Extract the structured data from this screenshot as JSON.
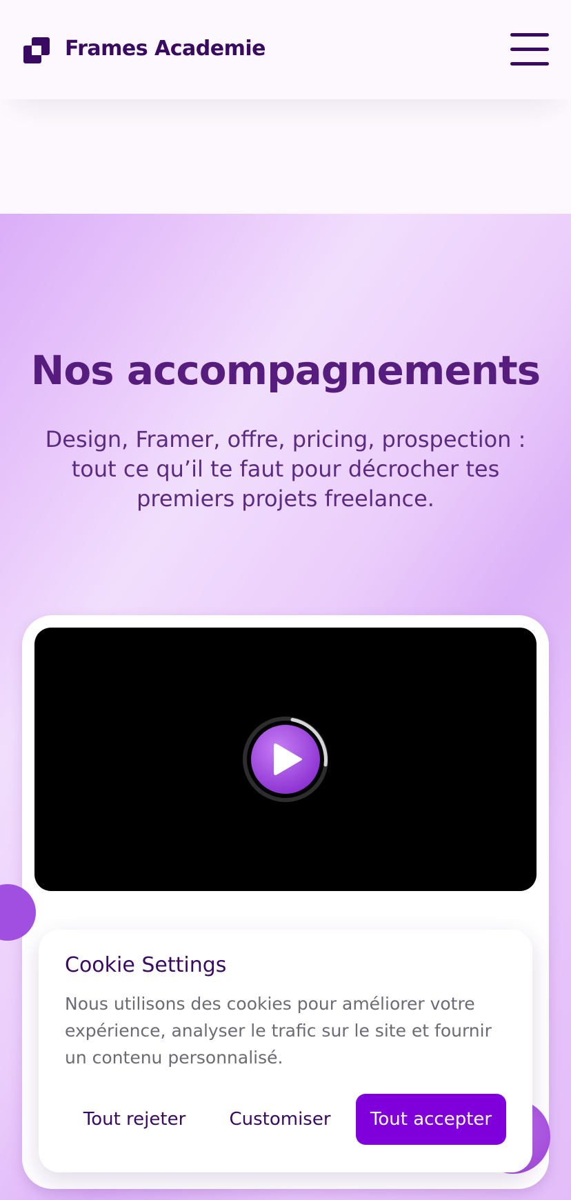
{
  "header": {
    "brand_name": "Frames Academie",
    "logo_icon": "stacked-squares-logo-icon",
    "menu_icon": "hamburger-menu-icon"
  },
  "hero": {
    "title": "Nos accompagnements",
    "subtitle": "Design, Framer, offre, pricing, prospection : tout ce qu’il te faut pour décrocher tes premiers projets freelance."
  },
  "video": {
    "play_icon": "play-icon"
  },
  "cookie_banner": {
    "title": "Cookie Settings",
    "text": "Nous utilisons des cookies pour améliorer votre expérience, analyser le trafic sur le site et fournir un contenu personnalisé.",
    "reject_label": "Tout rejeter",
    "customize_label": "Customiser",
    "accept_label": "Tout accepter"
  },
  "colors": {
    "brand_dark": "#3a0a62",
    "accent": "#8000dc",
    "hero_title": "#561d7e",
    "play_button": "#a04fe0"
  }
}
